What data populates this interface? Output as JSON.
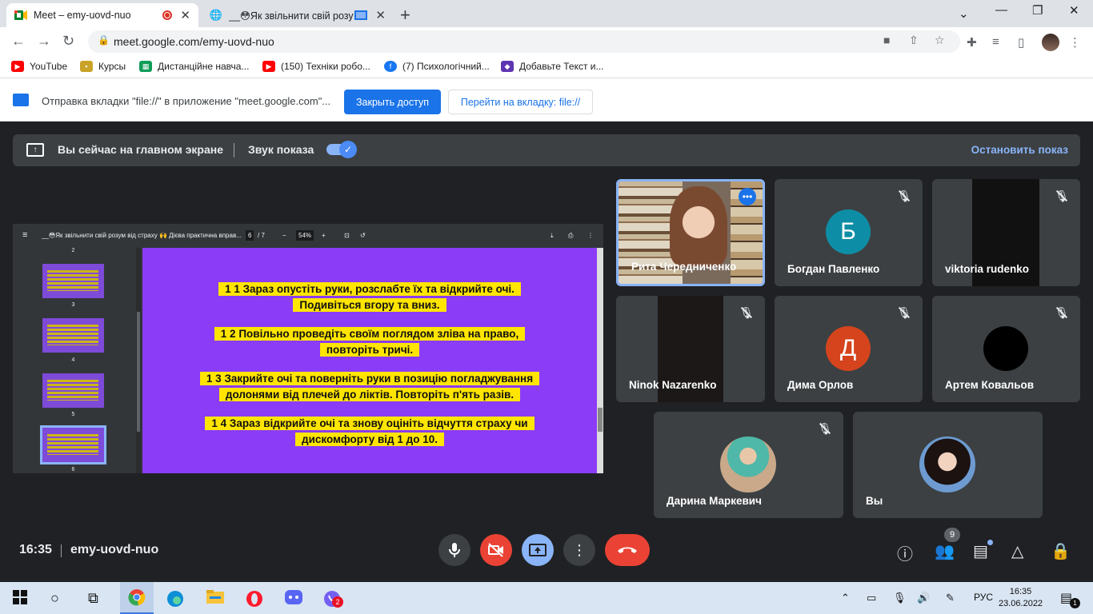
{
  "browser": {
    "tabs": [
      {
        "title": "Meet – emy-uovd-nuo",
        "active": true
      },
      {
        "title": "__😳Як звільнити свій розу",
        "active": false
      }
    ],
    "url": "meet.google.com/emy-uovd-nuo",
    "bookmarks": [
      {
        "label": "YouTube",
        "color": "#ff0000"
      },
      {
        "label": "Курсы",
        "color": "#c9a227"
      },
      {
        "label": "Дистанційне навча...",
        "color": "#0f9d58"
      },
      {
        "label": "(150) Техніки робо...",
        "color": "#ff0000"
      },
      {
        "label": "(7) Психологічний...",
        "color": "#1877f2"
      },
      {
        "label": "Добавьте Текст и...",
        "color": "#5e35b1"
      }
    ],
    "infobar": {
      "message": "Отправка вкладки \"file://\" в приложение \"meet.google.com\"...",
      "primary_button": "Закрыть доступ",
      "secondary_button": "Перейти на вкладку: file://"
    }
  },
  "presentation_bar": {
    "status": "Вы сейчас на главном экране",
    "audio_label": "Звук показа",
    "audio_enabled": true,
    "stop_label": "Остановить показ"
  },
  "pdf": {
    "title": "__😳Як звільнити свій розум від страху 🙌 Дієва практична вправ...",
    "page": "6",
    "page_total": "/ 7",
    "zoom": "54%",
    "thumbnails": [
      "2",
      "3",
      "4",
      "5",
      "6"
    ],
    "paragraphs": [
      "1  1  Зараз опустіть руки, розслабте їх та відкрийте очі. Подивіться вгору та вниз.",
      "1  2   Повільно проведіть своїм поглядом зліва на право, повторіть тричі.",
      "1  3  Закрийте очі та поверніть руки в позицію погладжування долонями від плечей до ліктів. Повторіть п'ять разів.",
      "1  4  Зараз відкрийте очі та знову оцініть відчуття страху чи дискомфорту від 1 до 10."
    ],
    "page_color": "#8b3cf7",
    "highlight_color": "#ffe500"
  },
  "participants": [
    {
      "name": "Рита Чередниченко",
      "type": "video",
      "active_speaker": true
    },
    {
      "name": "Богдан Павленко",
      "type": "letter",
      "letter": "Б",
      "color": "#0e8ea6",
      "muted": true
    },
    {
      "name": "viktoria rudenko",
      "type": "video-dark",
      "muted": true
    },
    {
      "name": "Ninok Nazarenko",
      "type": "video-dark",
      "muted": true
    },
    {
      "name": "Дима Орлов",
      "type": "letter",
      "letter": "Д",
      "color": "#d5441c",
      "muted": true
    },
    {
      "name": "Артем Ковальов",
      "type": "black-avatar",
      "muted": true
    },
    {
      "name": "Дарина Маркевич",
      "type": "photo",
      "muted": true
    },
    {
      "name": "Вы",
      "type": "photo"
    }
  ],
  "bottom": {
    "time": "16:35",
    "meeting_code": "emy-uovd-nuo",
    "participants_count": "9"
  },
  "taskbar": {
    "language": "РУС",
    "time": "16:35",
    "date": "23.06.2022",
    "viber_badge": "2",
    "notification_badge": "1"
  }
}
